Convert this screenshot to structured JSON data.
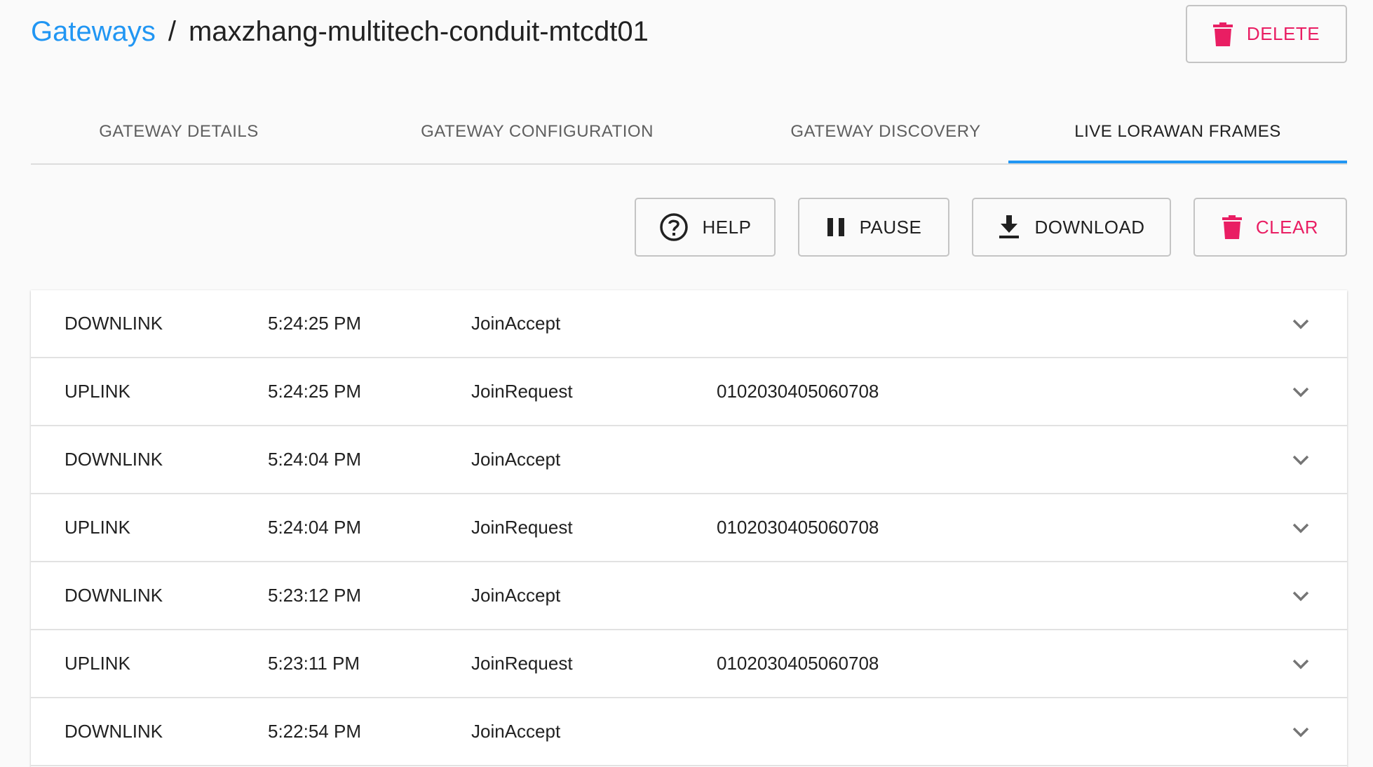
{
  "breadcrumb": {
    "link_label": "Gateways",
    "separator": "/",
    "title": "maxzhang-multitech-conduit-mtcdt01"
  },
  "header_actions": {
    "delete_label": "DELETE"
  },
  "tabs": [
    {
      "label": "GATEWAY DETAILS",
      "active": false
    },
    {
      "label": "GATEWAY CONFIGURATION",
      "active": false
    },
    {
      "label": "GATEWAY DISCOVERY",
      "active": false
    },
    {
      "label": "LIVE LORAWAN FRAMES",
      "active": true
    }
  ],
  "toolbar": {
    "help_label": "HELP",
    "pause_label": "PAUSE",
    "download_label": "DOWNLOAD",
    "clear_label": "CLEAR"
  },
  "icons": {
    "delete": "trash-icon",
    "help": "help-circle-icon",
    "pause": "pause-icon",
    "download": "download-icon",
    "clear": "trash-icon",
    "expand": "chevron-down-icon"
  },
  "colors": {
    "link": "#2196f3",
    "danger": "#e91e63",
    "active_tab_indicator": "#2196f3"
  },
  "frames": [
    {
      "direction": "DOWNLINK",
      "time": "5:24:25 PM",
      "type": "JoinAccept",
      "dev_eui": ""
    },
    {
      "direction": "UPLINK",
      "time": "5:24:25 PM",
      "type": "JoinRequest",
      "dev_eui": "0102030405060708"
    },
    {
      "direction": "DOWNLINK",
      "time": "5:24:04 PM",
      "type": "JoinAccept",
      "dev_eui": ""
    },
    {
      "direction": "UPLINK",
      "time": "5:24:04 PM",
      "type": "JoinRequest",
      "dev_eui": "0102030405060708"
    },
    {
      "direction": "DOWNLINK",
      "time": "5:23:12 PM",
      "type": "JoinAccept",
      "dev_eui": ""
    },
    {
      "direction": "UPLINK",
      "time": "5:23:11 PM",
      "type": "JoinRequest",
      "dev_eui": "0102030405060708"
    },
    {
      "direction": "DOWNLINK",
      "time": "5:22:54 PM",
      "type": "JoinAccept",
      "dev_eui": ""
    }
  ]
}
